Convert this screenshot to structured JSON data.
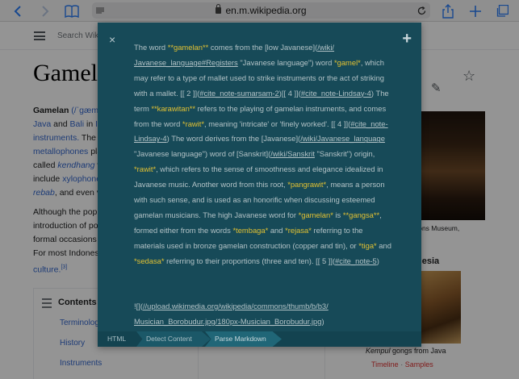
{
  "browser": {
    "url": "en.m.wikipedia.org",
    "icons": [
      "back-icon",
      "forward-icon",
      "bookmarks-icon",
      "reader-icon",
      "lock-icon",
      "reload-icon",
      "share-icon",
      "new-tab-icon",
      "tabs-icon"
    ]
  },
  "wiki": {
    "search_placeholder": "Search Wiki",
    "title": "Gamela",
    "para1": {
      "l1_bold": "Gamelan",
      "l1_rest": " (/ˈɡæm",
      "l2a": "Java",
      "l2b": " and ",
      "l2c": "Bali",
      "l2d": " in ",
      "l2e": "In",
      "l3": "instruments.",
      "l3b": " The m",
      "l4": "metallophones",
      "l4b": " pla",
      "l5": "called ",
      "l5b": "kendhang",
      "l5c": " v",
      "l6": "include ",
      "l6b": "xylophone",
      "l7": "rebab",
      "l7b": ", and even v"
    },
    "para2": {
      "l1": "Although the popu",
      "l2": "introduction of po",
      "l3": "formal occasions",
      "l4": "For most Indones",
      "l5": "culture.",
      "l5_ref": "[3]"
    },
    "contents": {
      "title": "Contents",
      "items": [
        "Terminolog",
        "History",
        "Instruments"
      ]
    },
    "photo1_caption": "sations Museum,",
    "infobox_title": "nesia",
    "photo2_caption_italic": "Kempul",
    "photo2_caption_rest": " gongs from Java",
    "links": [
      "Timeline",
      "Samples"
    ],
    "links_sep": " · "
  },
  "modal": {
    "close_label": "×",
    "add_label": "+",
    "md": {
      "s1": "The word ",
      "h1": "**gamelan**",
      "s2": " comes from the [low Javanese](",
      "u1": "/wiki/",
      "u1b": "Javanese_language#Registers",
      "s3": " \"Javanese language\") word ",
      "h2": "*gamel*",
      "s4": ", which may refer to a type of mallet used to strike instruments or the act of striking with a mallet. [[ 2 ]](",
      "u2": "#cite_note-sumarsam-2",
      "s5": ")[[ 4 ]](",
      "u3": "#cite_note-Lindsay-4",
      "s6": ") The term ",
      "h3": "**karawitan**",
      "s7": " refers to the playing of gamelan instruments, and comes from the word ",
      "h4": "*rawit*",
      "s8": ", meaning 'intricate' or 'finely worked'. [[ 4 ]](",
      "u4": "#cite_note-Lindsay-4",
      "s9": ") The word derives from the [Javanese](",
      "u5": "/wiki/Javanese_language",
      "s10": " \"Javanese language\") word of [Sanskrit](",
      "u6": "/wiki/Sanskrit",
      "s11": " \"Sanskrit\") origin, ",
      "h5": "*rawit*",
      "s12": ", which refers to the sense of smoothness and elegance idealized in Javanese music. Another word from this root, ",
      "h6": "*pangrawit*",
      "s13": ", means a person with such sense, and is used as an honorific when discussing esteemed gamelan musicians. The high Javanese word for ",
      "h7": "*gamelan*",
      "s14": " is ",
      "h8": "**gangsa**",
      "s15": ", formed either from the words ",
      "h9": "*tembaga*",
      "s16": " and ",
      "h10": "*rejasa*",
      "s17": " referring to the materials used in bronze gamelan construction (copper and tin), or ",
      "h11": "*tiga*",
      "s18": " and ",
      "h12": "*sedasa*",
      "s19": " referring to their proportions (three and ten). [[ 5 ]](",
      "u7": "#cite_note-5",
      "s20": ")"
    },
    "tail": {
      "t1": "![](",
      "u1": "//upload.wikimedia.org/wikipedia/commons/thumb/b/b3/",
      "u2": "Musician_Borobudur.jpg/180px-Musician_Borobudur.jpg",
      "t2": ")"
    },
    "breadcrumbs": [
      "HTML",
      "Detect Content",
      "Parse Markdown"
    ]
  }
}
